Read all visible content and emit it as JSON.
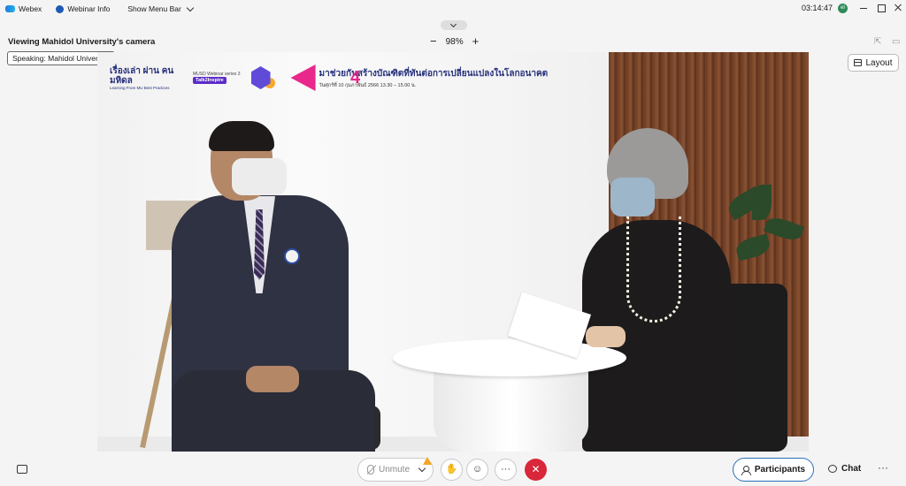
{
  "titlebar": {
    "app_name": "Webex",
    "webinar_info": "Webinar Info",
    "show_menu_bar": "Show Menu Bar",
    "time": "03:14:47",
    "avatar_initial": "el"
  },
  "header": {
    "viewing": "Viewing Mahidol University's camera",
    "zoom_level": "98%",
    "zoom_out": "−",
    "zoom_in": "+",
    "speaking": "Speaking: Mahidol University",
    "layout_label": "Layout"
  },
  "video_banner": {
    "brand": "เรื่องเล่า ผ่าน คนมหิดล",
    "brand_sub": "Learning From MU Best Practices",
    "talk_sub": "MUSD Webinar series 3",
    "talk_label": "Talk2Inspire",
    "episode": "4",
    "headline": "มาช่วยกันสร้างบัณฑิตที่ทันต่อการเปลี่ยนแปลงในโลกอนาคต",
    "date_line": "วันศุกร์ที่ 10 กุมภาพันธ์ 2566  13.30 – 15.00 น."
  },
  "controls": {
    "unmute_label": "Unmute",
    "participants_label": "Participants",
    "chat_label": "Chat",
    "more_label": "···",
    "end_label": "✕"
  },
  "icons": [
    "webex-logo-icon",
    "info-icon",
    "chevron-down-icon",
    "minimize-icon",
    "maximize-icon",
    "close-icon",
    "layout-icon",
    "captions-icon",
    "mic-off-icon",
    "warning-icon",
    "raise-hand-icon",
    "reactions-icon",
    "more-icon",
    "end-call-icon",
    "participants-icon",
    "chat-icon"
  ],
  "colors": {
    "accent": "#2a6fb8",
    "end_call": "#d9263a",
    "warning": "#f5a623"
  }
}
